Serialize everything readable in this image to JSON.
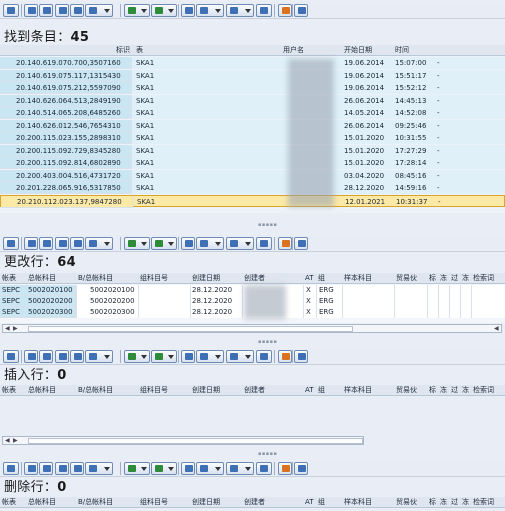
{
  "sections": {
    "found": {
      "label": "找到条目",
      "count": "45"
    },
    "changed": {
      "label": "更改行",
      "count": "64"
    },
    "inserted": {
      "label": "插入行",
      "count": "0"
    },
    "deleted": {
      "label": "删除行",
      "count": "0"
    }
  },
  "top_grid": {
    "headers": [
      "标识",
      "表",
      "用户名",
      "开始日期",
      "时间"
    ],
    "rows": [
      {
        "id": "20.140.619.070.700,3507160",
        "table": "SKA1",
        "date": "19.06.2014",
        "time": "15:07:00",
        "flag": "-"
      },
      {
        "id": "20.140.619.075.117,1315430",
        "table": "SKA1",
        "date": "19.06.2014",
        "time": "15:51:17",
        "flag": "-"
      },
      {
        "id": "20.140.619.075.212,5597090",
        "table": "SKA1",
        "date": "19.06.2014",
        "time": "15:52:12",
        "flag": "-"
      },
      {
        "id": "20.140.626.064.513,2849190",
        "table": "SKA1",
        "date": "26.06.2014",
        "time": "14:45:13",
        "flag": "-"
      },
      {
        "id": "20.140.514.065.208,6485260",
        "table": "SKA1",
        "date": "14.05.2014",
        "time": "14:52:08",
        "flag": "-"
      },
      {
        "id": "20.140.626.012.546,7654310",
        "table": "SKA1",
        "date": "26.06.2014",
        "time": "09:25:46",
        "flag": "-"
      },
      {
        "id": "20.200.115.023.155,2898310",
        "table": "SKA1",
        "date": "15.01.2020",
        "time": "10:31:55",
        "flag": "-"
      },
      {
        "id": "20.200.115.092.729,8345280",
        "table": "SKA1",
        "date": "15.01.2020",
        "time": "17:27:29",
        "flag": "-"
      },
      {
        "id": "20.200.115.092.814,6802890",
        "table": "SKA1",
        "date": "15.01.2020",
        "time": "17:28:14",
        "flag": "-"
      },
      {
        "id": "20.200.403.004.516,4731720",
        "table": "SKA1",
        "date": "03.04.2020",
        "time": "08:45:16",
        "flag": "-"
      },
      {
        "id": "20.201.228.065.916,5317850",
        "table": "SKA1",
        "date": "28.12.2020",
        "time": "14:59:16",
        "flag": "-"
      },
      {
        "id": "20.210.112.023.137,9847280",
        "table": "SKA1",
        "date": "12.01.2021",
        "time": "10:31:37",
        "flag": "-"
      }
    ]
  },
  "detail_headers": [
    "帐表",
    "总帐科目",
    "B/总帐科目",
    "组科目号",
    "创建日期",
    "创建者",
    "AT",
    "组",
    "样本科目",
    "贸易伙",
    "标",
    "冻",
    "过",
    "冻",
    "检索词"
  ],
  "changed_rows": [
    {
      "ktopl": "SEPC",
      "saknr": "5002020100",
      "bilkt": "5002020100",
      "date": "28.12.2020",
      "at": "X",
      "grp": "ERG"
    },
    {
      "ktopl": "SEPC",
      "saknr": "5002020200",
      "bilkt": "5002020200",
      "date": "28.12.2020",
      "at": "X",
      "grp": "ERG"
    },
    {
      "ktopl": "SEPC",
      "saknr": "5002020300",
      "bilkt": "5002020300",
      "date": "28.12.2020",
      "at": "X",
      "grp": "ERG"
    }
  ],
  "colors": {
    "row_light": "#dff0f8",
    "row_selected": "#fde9a6",
    "key_col": "#c9e6f2",
    "header": "#dfe6ef"
  }
}
